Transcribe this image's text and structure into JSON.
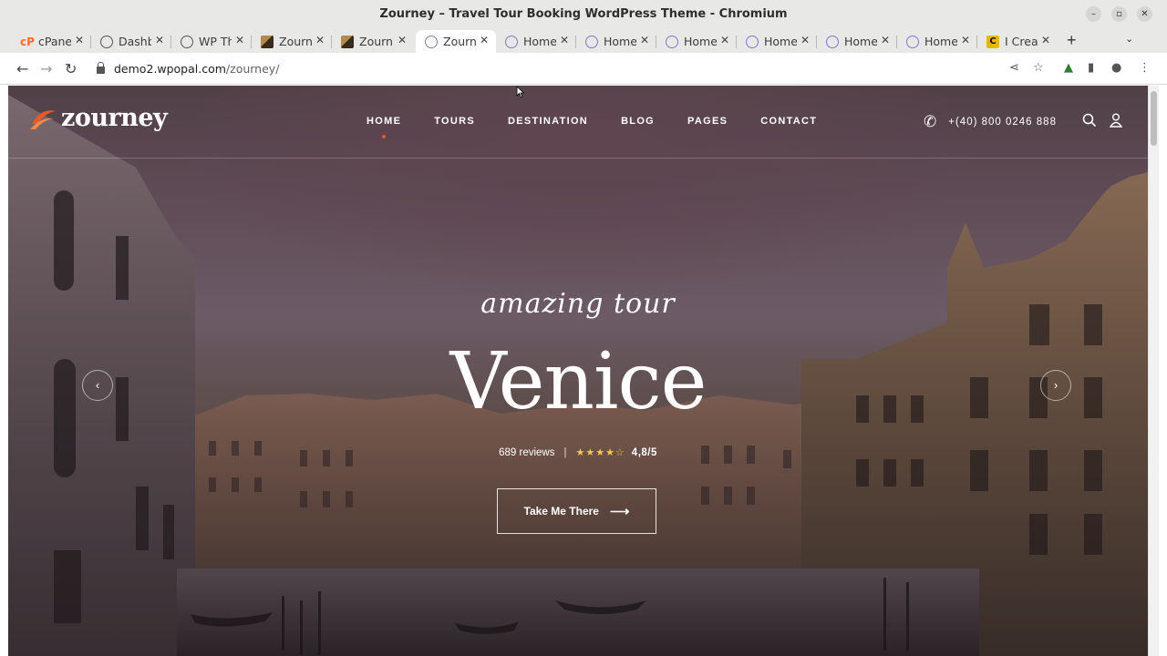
{
  "window": {
    "title": "Zourney – Travel Tour Booking WordPress Theme - Chromium"
  },
  "tabs": [
    {
      "label": "cPanel",
      "icon": "cpanel-icon"
    },
    {
      "label": "Dashboard",
      "icon": "globe-icon"
    },
    {
      "label": "WP Th",
      "icon": "globe-icon"
    },
    {
      "label": "Zourney",
      "icon": "zourney-favicon"
    },
    {
      "label": "Zourney",
      "icon": "zourney-favicon"
    },
    {
      "label": "Zourney",
      "icon": "loading-ring-icon",
      "active": true
    },
    {
      "label": "Home",
      "icon": "loading-ring-icon"
    },
    {
      "label": "Home",
      "icon": "loading-ring-icon"
    },
    {
      "label": "Home",
      "icon": "loading-ring-icon"
    },
    {
      "label": "Home",
      "icon": "loading-ring-icon"
    },
    {
      "label": "Home",
      "icon": "loading-ring-icon"
    },
    {
      "label": "Home",
      "icon": "loading-ring-icon"
    },
    {
      "label": "I Crea",
      "icon": "c-favicon"
    }
  ],
  "address": {
    "domain": "demo2.wpopal.com",
    "path": "/zourney/"
  },
  "site": {
    "logo_text": "zourney",
    "nav": [
      {
        "label": "HOME",
        "active": true
      },
      {
        "label": "TOURS"
      },
      {
        "label": "DESTINATION"
      },
      {
        "label": "BLOG"
      },
      {
        "label": "PAGES"
      },
      {
        "label": "CONTACT"
      }
    ],
    "phone": "+(40) 800 0246 888"
  },
  "hero": {
    "subtitle": "amazing tour",
    "title": "Venice",
    "reviews": "689 reviews",
    "stars": "★★★★☆",
    "score": "4,8/5",
    "cta_label": "Take Me There"
  },
  "colors": {
    "accent": "#e85a2a",
    "stars": "#f2c94c",
    "active_tab_ring": "#7b79c9"
  }
}
